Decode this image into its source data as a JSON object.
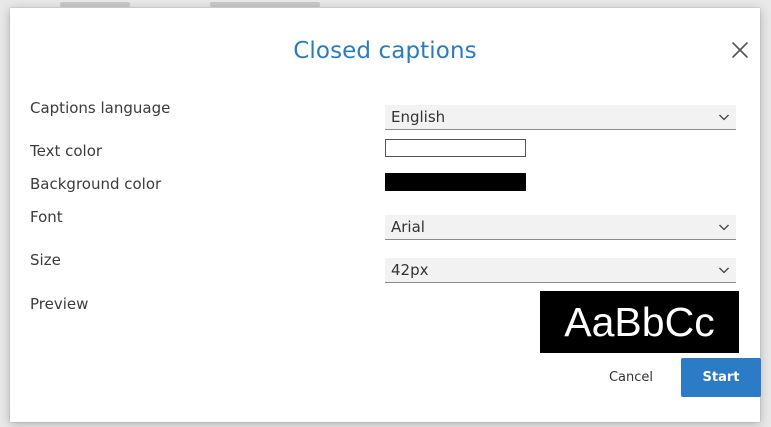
{
  "dialog": {
    "title": "Closed captions",
    "close_icon": "close-icon"
  },
  "fields": {
    "captions_language": {
      "label": "Captions language",
      "value": "English"
    },
    "text_color": {
      "label": "Text color",
      "value": "#ffffff"
    },
    "background_color": {
      "label": "Background color",
      "value": "#000000"
    },
    "font": {
      "label": "Font",
      "value": "Arial"
    },
    "size": {
      "label": "Size",
      "value": "42px"
    },
    "preview": {
      "label": "Preview",
      "sample_text": "AaBbCc"
    }
  },
  "buttons": {
    "cancel_label": "Cancel",
    "start_label": "Start"
  },
  "colors": {
    "accent": "#2b7bc6",
    "title": "#2a7bc0"
  }
}
